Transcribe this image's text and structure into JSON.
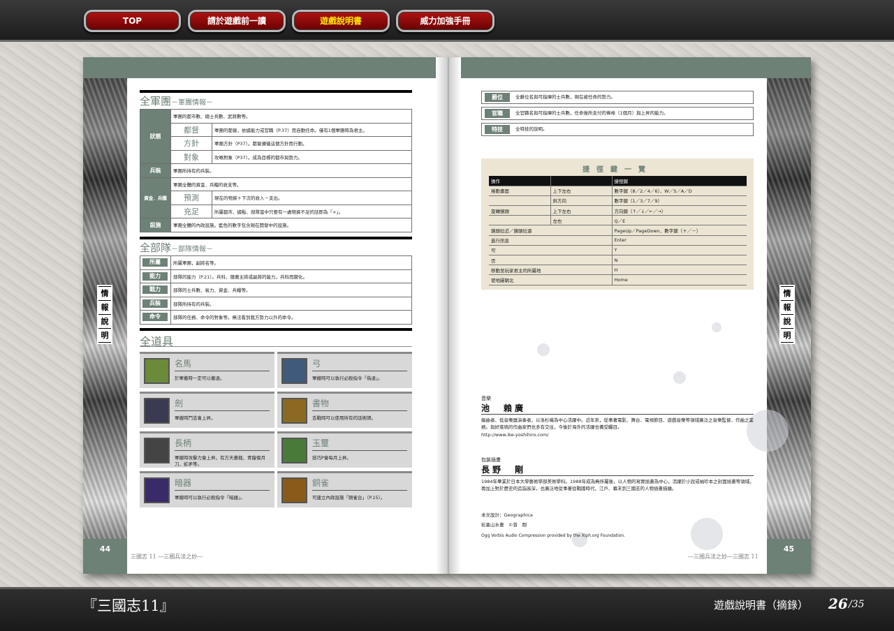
{
  "nav": {
    "buttons": [
      {
        "label": "TOP"
      },
      {
        "label": "請於遊戲前一讀"
      },
      {
        "label": "遊戲說明書"
      },
      {
        "label": "威力加強手冊"
      }
    ]
  },
  "footer": {
    "game_title": "『三國志11』",
    "doc_title": "遊戲說明書（摘錄）",
    "page_current": "26",
    "page_total": "/35"
  },
  "book": {
    "left_page_number": "44",
    "right_page_number": "45",
    "left_footer": "三國志 11 ―三國兵法之妙―",
    "right_footer": "―三國兵法之妙―三國志 11",
    "side_tab": [
      "情",
      "報",
      "說",
      "明"
    ],
    "army": {
      "title": "全軍團",
      "subtitle": "－軍團情報－",
      "rows": {
        "status_label": "狀態",
        "status_desc": "軍團的都市數、總士兵數、武將數等。",
        "dutoku": "都督",
        "dutoku_desc": "軍團的都督，依據能力或官職（P.37）而自動任命。僅有1個軍團時為君主。",
        "houshin": "方針",
        "houshin_desc": "軍團方針（P37）。都督遵循這個方針而行動。",
        "taishou": "對象",
        "taishou_desc": "攻略對象（P37）。成為目標的都市與勢力。",
        "heisou": "兵裝",
        "heisou_desc": "軍團所持有的兵裝。",
        "shikin_label": "資金．兵糧",
        "shikin_desc": "軍團全體的資金．兵糧的收支等。",
        "yosoku": "預測",
        "yosoku_desc": "現在的物資＋下次的收入－支出。",
        "jusoku": "充足",
        "jusoku_desc": "所屬都市、據點、部隊當中只要有一處物資不足的話即為「×」。",
        "shisetsu": "設施",
        "shisetsu_desc": "軍團全體的內政設施。藍色的數字包含現在開發中的設施。"
      }
    },
    "unit": {
      "title": "全部隊",
      "subtitle": "－部隊情報－",
      "rows": [
        {
          "label": "所屬",
          "desc": "所屬軍團，副將名等。"
        },
        {
          "label": "能力",
          "desc": "部隊的能力（P.21）。兵科、隨著主將或副將的能力，兵科而變化。"
        },
        {
          "label": "戰力",
          "desc": "部隊的士兵數、氣力、資金、兵糧等。"
        },
        {
          "label": "兵裝",
          "desc": "部隊所持有的兵裝。"
        },
        {
          "label": "命令",
          "desc": "部隊的任務、命令的對象等。無法看到我方勢力以外的命令。"
        }
      ]
    },
    "items": {
      "title": "全道具",
      "list": [
        {
          "name": "名馬",
          "desc": "於軍撤時一定可以撤退。",
          "icon": "horse-icon",
          "color": "#6b8a3a"
        },
        {
          "name": "弓",
          "desc": "軍撤時可以執行必殺指令「偽退」。",
          "icon": "bow-icon",
          "color": "#3f5a7a"
        },
        {
          "name": "劍",
          "desc": "軍撤時鬥志會上昇。",
          "icon": "sword-icon",
          "color": "#3a3a52"
        },
        {
          "name": "書物",
          "desc": "舌戰時可以使用所有的話術牌。",
          "icon": "book-icon",
          "color": "#8a6a22"
        },
        {
          "name": "長柄",
          "desc": "軍撤時攻擊力會上昇。有方天畫戟、青龍偃月刀、蛇矛等。",
          "icon": "polearm-icon",
          "color": "#444"
        },
        {
          "name": "玉璽",
          "desc": "技巧P會每月上昇。",
          "icon": "seal-icon",
          "color": "#4a7a3a"
        },
        {
          "name": "暗器",
          "desc": "軍撤時可以執行必殺指令「暗器」。",
          "icon": "hidden-weapon-icon",
          "color": "#3a2a6a"
        },
        {
          "name": "銅雀",
          "desc": "可建立內政設施「銅雀台」（P.15）。",
          "icon": "bronze-bird-icon",
          "color": "#8a5a1a"
        }
      ]
    },
    "right_boxes": [
      {
        "label": "爵位",
        "desc": "全爵位名與可指揮的士兵數，現在被任命的勢力。"
      },
      {
        "label": "官職",
        "desc": "全官職名與可指揮的士兵數，任命後所支付的俸祿（1個月）與上昇的能力。"
      },
      {
        "label": "特技",
        "desc": "全特技的說明。"
      }
    ],
    "shortcuts": {
      "title": "捷徑鍵一覽",
      "header": [
        "操作",
        "",
        "捷徑鍵"
      ],
      "rows": [
        [
          "捲動畫面",
          "上下左右",
          "數字鍵（8／2／4／6）、W／S／A／D"
        ],
        [
          "",
          "斜方向",
          "數字鍵（1／3／7／9）"
        ],
        [
          "旋轉鏡頭",
          "上下左右",
          "方向鍵（↑／↓／←／→）"
        ],
        [
          "",
          "左右",
          "Q／E"
        ],
        [
          "鏡頭拉近／鏡頭拉遠",
          "",
          "PageUp／PageDown、數字鍵（＋／－）"
        ],
        [
          "進行訊息",
          "",
          "Enter"
        ],
        [
          "可",
          "",
          "Y"
        ],
        [
          "否",
          "",
          "N"
        ],
        [
          "移動至玩家君主的所屬地",
          "",
          "H"
        ],
        [
          "使地圖朝北",
          "",
          "Home"
        ]
      ]
    },
    "credits": {
      "music_label": "音樂",
      "music_name": "池　賴廣",
      "music_bio": "編曲者、低音樂器演奏者，以洛杉磯為中心活躍中。近年來，從事著電影、舞台、電視節目、遊戲音樂等領域廣泛之音樂監督、作曲之業務。與好萊塢的作曲家們也多有交往，今後於海外的活躍也備受矚目。",
      "music_url": "http://www.ike-yoshihiro.com/",
      "art_label": "包裝插畫",
      "art_name": "長野　剛",
      "art_bio": "1984年畢業於日本大學藝術學部美術學科。1988年成為無所屬後，以人物的寫實插畫為中心，活躍於小說或袖珍本之封面插畫等領域。再加上對於歷史的造詣高深，也廣泛地從事著從戰國時代、江戶、幕末到三國志的人物插畫描繪。",
      "design": "本文設計：Geographica",
      "ink": "彩墨山水畫　©曾　剛",
      "ogg": "Ogg Vorbis Audio Compression provided by the Xiph.org Foundation."
    }
  },
  "colors": {
    "accent": "#6d8176",
    "nav_red": "#9c0d0d",
    "nav_active_text": "#ffe500"
  }
}
